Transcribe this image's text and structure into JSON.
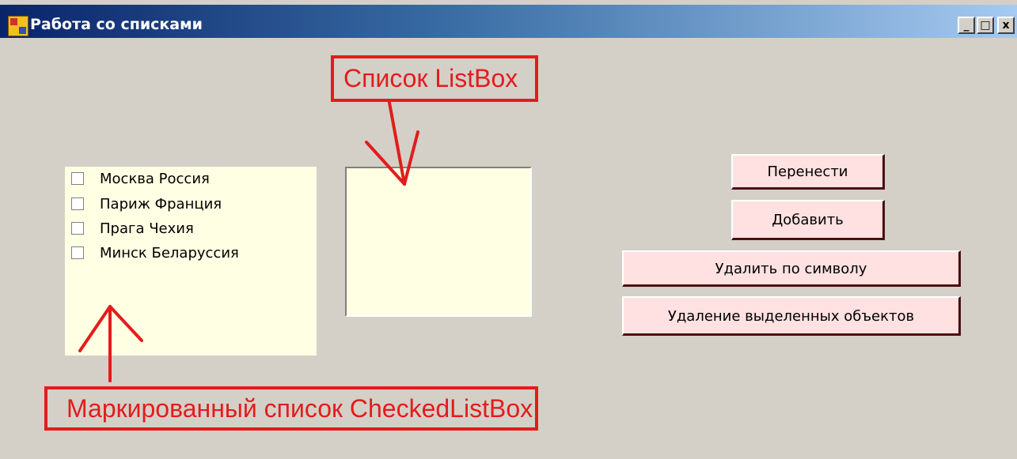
{
  "window": {
    "title": "Работа со списками",
    "controls": {
      "minimize": "_",
      "maximize": "□",
      "close": "x"
    }
  },
  "checked_list_box": {
    "items": [
      {
        "label": "Москва Россия",
        "checked": false
      },
      {
        "label": "Париж Франция",
        "checked": false
      },
      {
        "label": "Прага Чехия",
        "checked": false
      },
      {
        "label": "Минск Беларуссия",
        "checked": false
      }
    ]
  },
  "list_box": {
    "items": []
  },
  "buttons": {
    "transfer": "Перенести",
    "add": "Добавить",
    "delete_by_char": "Удалить по символу",
    "delete_selected": "Удаление выделенных объектов"
  },
  "annotations": {
    "listbox_label": "Список ListBox",
    "checked_list_label": "Маркированный список CheckedListBox"
  },
  "colors": {
    "list_bg": "#ffffe4",
    "button_bg": "#ffe1e1",
    "annotation_red": "#e31c1c",
    "form_bg": "#d4d0c8"
  }
}
